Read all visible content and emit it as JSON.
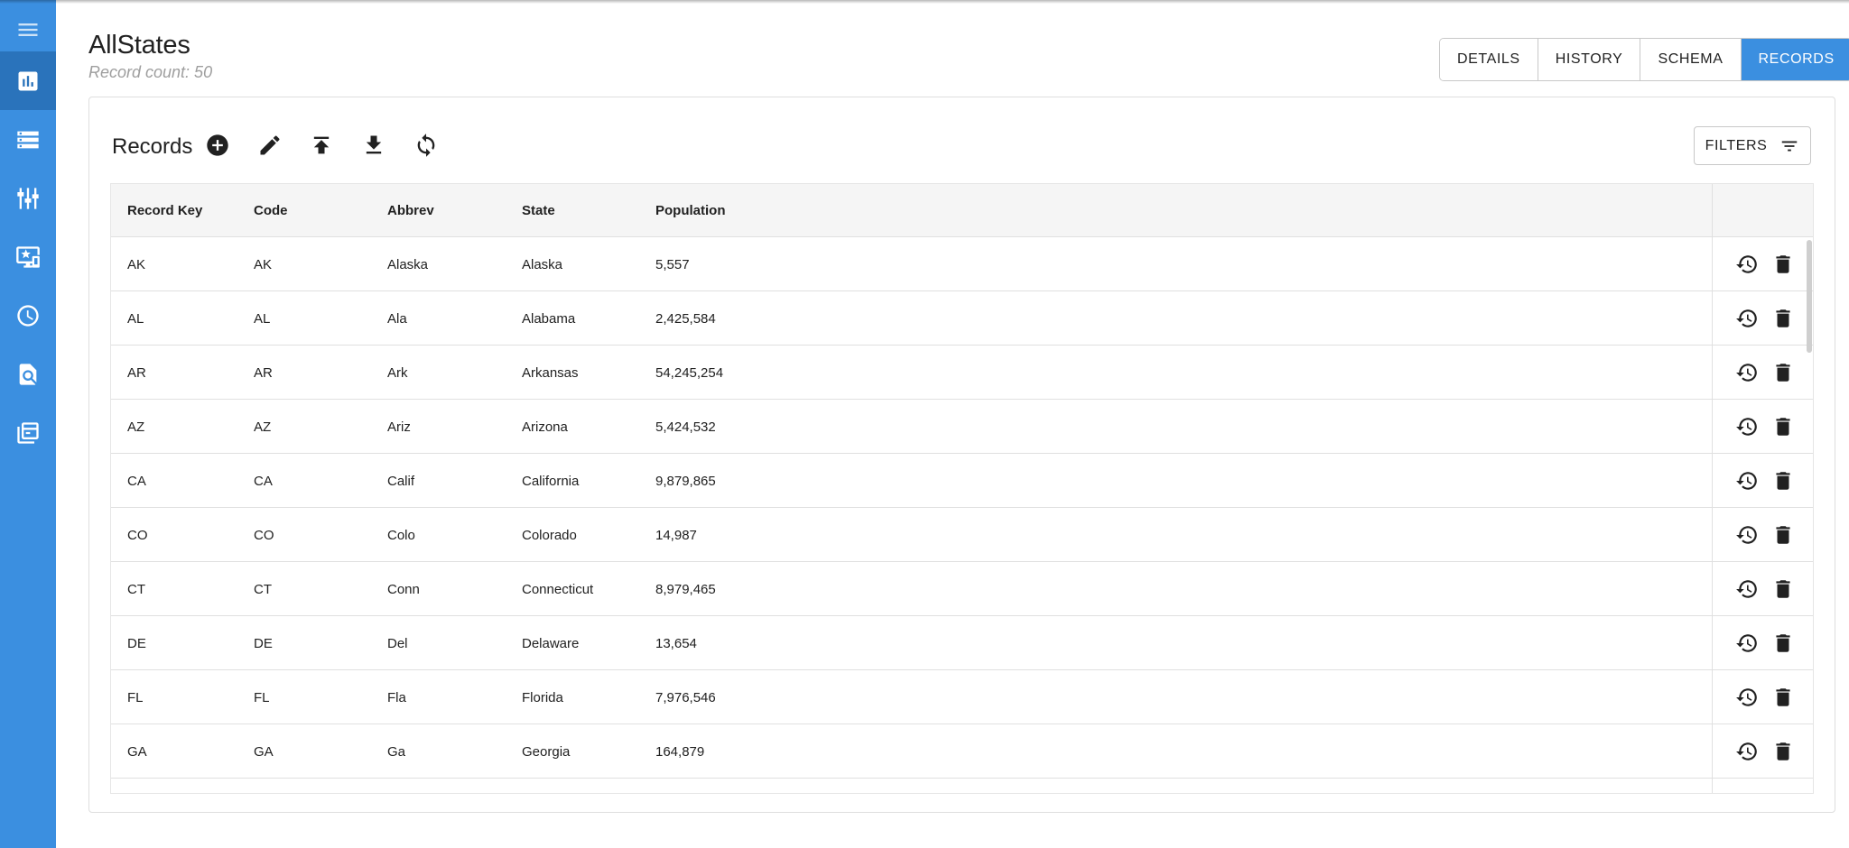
{
  "sidebar": {
    "items": [
      {
        "icon": "menu-icon"
      },
      {
        "icon": "bar-chart-icon",
        "active": true
      },
      {
        "icon": "storage-icon"
      },
      {
        "icon": "sliders-icon"
      },
      {
        "icon": "monitor-star-icon"
      },
      {
        "icon": "clock-icon"
      },
      {
        "icon": "find-in-page-icon"
      },
      {
        "icon": "library-icon"
      }
    ]
  },
  "header": {
    "title": "AllStates",
    "record_count": "Record count: 50",
    "tabs": [
      {
        "label": "DETAILS"
      },
      {
        "label": "HISTORY"
      },
      {
        "label": "SCHEMA"
      },
      {
        "label": "RECORDS",
        "active": true
      }
    ]
  },
  "records": {
    "title": "Records",
    "toolbar": [
      "add-circle-icon",
      "edit-icon",
      "upload-icon",
      "download-icon",
      "refresh-icon"
    ],
    "filters_label": "FILTERS",
    "columns": [
      "Record Key",
      "Code",
      "Abbrev",
      "State",
      "Population"
    ],
    "rows": [
      [
        "AK",
        "AK",
        "Alaska",
        "Alaska",
        "5,557"
      ],
      [
        "AL",
        "AL",
        "Ala",
        "Alabama",
        "2,425,584"
      ],
      [
        "AR",
        "AR",
        "Ark",
        "Arkansas",
        "54,245,254"
      ],
      [
        "AZ",
        "AZ",
        "Ariz",
        "Arizona",
        "5,424,532"
      ],
      [
        "CA",
        "CA",
        "Calif",
        "California",
        "9,879,865"
      ],
      [
        "CO",
        "CO",
        "Colo",
        "Colorado",
        "14,987"
      ],
      [
        "CT",
        "CT",
        "Conn",
        "Connecticut",
        "8,979,465"
      ],
      [
        "DE",
        "DE",
        "Del",
        "Delaware",
        "13,654"
      ],
      [
        "FL",
        "FL",
        "Fla",
        "Florida",
        "7,976,546"
      ],
      [
        "GA",
        "GA",
        "Ga",
        "Georgia",
        "164,879"
      ]
    ]
  },
  "colors": {
    "sidebar": "#3b8fe0",
    "sidebar_active": "#2a73bb",
    "accent": "#3b8fe0"
  }
}
